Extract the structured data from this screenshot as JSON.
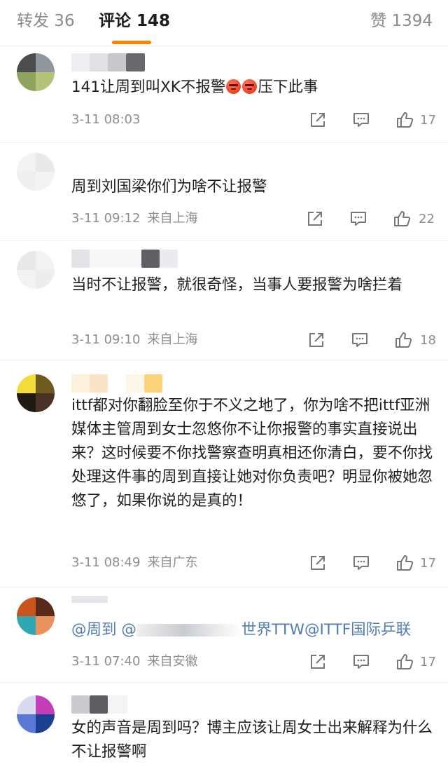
{
  "tabs": {
    "repost": "转发 36",
    "comments": "评论 148",
    "likes": "赞 1394"
  },
  "colors": {
    "accent": "#ff8200",
    "mention": "#507daf",
    "meta": "#8d8d8d"
  },
  "icons": [
    "share-icon",
    "comment-icon",
    "thumbs-up-icon",
    "angry-emoji-icon"
  ],
  "comments": [
    {
      "text_a": "141让周到叫XK不报警",
      "text_b": "压下此事",
      "time": "3-11 08:03",
      "location": "",
      "likes": "17"
    },
    {
      "text": "周到刘国梁你们为啥不让报警",
      "time": "3-11 09:12",
      "location": "来自上海",
      "likes": "22"
    },
    {
      "text": "当时不让报警，就很奇怪，当事人要报警为啥拦着",
      "time": "3-11 09:10",
      "location": "来自上海",
      "likes": "18"
    },
    {
      "text": "ittf都对你翻脸至你于不义之地了，你为啥不把ittf亚洲媒体主管周到女士忽悠你不让你报警的事实直接说出来？这时候要不你找警察查明真相还你清白，要不你找处理这件事的周到直接让她对你负责吧？明显你被她忽悠了，如果你说的是真的！",
      "time": "3-11 08:49",
      "location": "来自广东",
      "likes": "17"
    },
    {
      "mention_a": "@周到",
      "mention_b": "@",
      "mention_c": "世界TTW@ITTF国际乒联",
      "time": "3-11 07:40",
      "location": "来自安徽",
      "likes": "17"
    },
    {
      "text": "女的声音是周到吗？博主应该让周女士出来解释为什么不让报警啊"
    }
  ]
}
